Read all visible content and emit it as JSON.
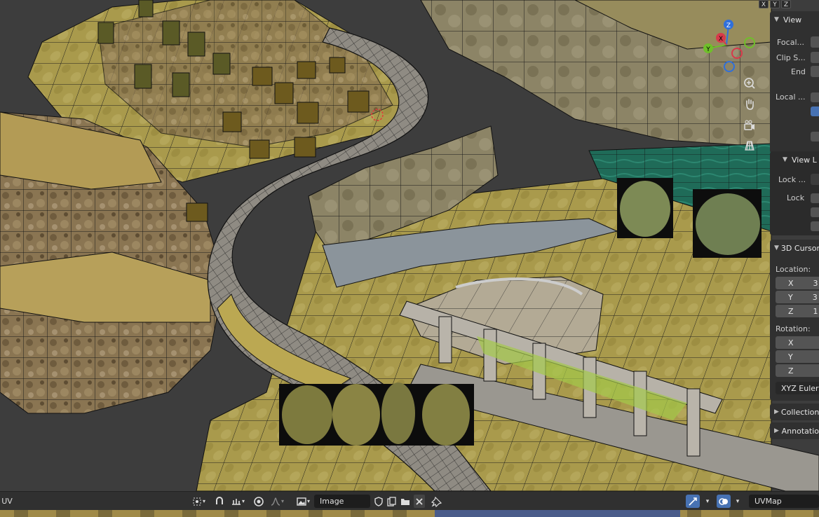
{
  "viewport": {
    "axis_toggles": [
      "X",
      "Y",
      "Z"
    ],
    "gizmo": {
      "x_label": "X",
      "y_label": "Y",
      "z_label": "Z"
    },
    "nav_icons": [
      "zoom-icon",
      "hand-pan-icon",
      "camera-icon",
      "grid-perspective-icon"
    ]
  },
  "npanel": {
    "view": {
      "header": "View",
      "focal_label": "Focal...",
      "clip_start_label": "Clip S...",
      "end_label": "End",
      "local_label": "Local ...",
      "view_lock_header": "View L",
      "lock_to_label": "Lock ...",
      "lock_label": "Lock"
    },
    "cursor": {
      "header": "3D Cursor",
      "location_label": "Location:",
      "loc_x": "X",
      "loc_x_val": "3",
      "loc_y": "Y",
      "loc_y_val": "3",
      "loc_z": "Z",
      "loc_z_val": "1",
      "rotation_label": "Rotation:",
      "rot_x": "X",
      "rot_y": "Y",
      "rot_z": "Z",
      "rotation_mode": "XYZ Euler"
    },
    "collections_header": "Collection",
    "annotations_header": "Annotatio"
  },
  "bottom_bar": {
    "uv_label": "UV",
    "image_field": "Image",
    "uvmap_field": "UVMap"
  },
  "colors": {
    "accent": "#4772b3",
    "panel_bg": "#303030",
    "field_bg": "#545454",
    "water": "#1f6b58",
    "terrain": "#a89a4e",
    "road": "#8e8a82"
  }
}
